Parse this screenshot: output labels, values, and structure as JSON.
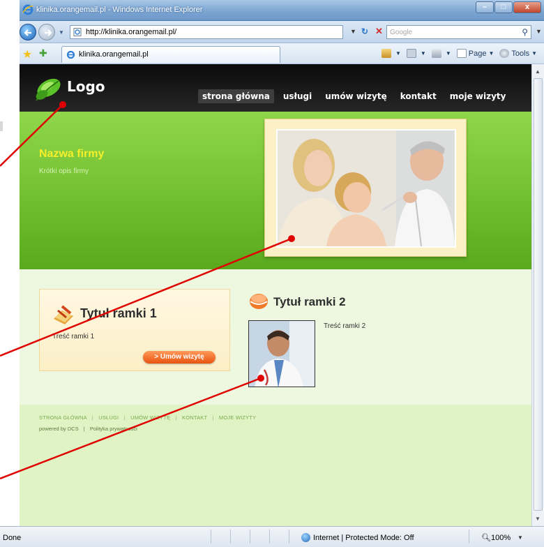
{
  "window": {
    "title": "klinika.orangemail.pl - Windows Internet Explorer",
    "controls": [
      "–",
      "□",
      "x"
    ]
  },
  "address_bar": {
    "url": "http://klinika.orangemail.pl/",
    "search_placeholder": "Google"
  },
  "tab": {
    "label": "klinika.orangemail.pl"
  },
  "command_bar": {
    "page_label": "Page",
    "tools_label": "Tools"
  },
  "site": {
    "logo_text": "Logo",
    "nav": [
      {
        "label": "strona główna",
        "active": true
      },
      {
        "label": "usługi",
        "active": false
      },
      {
        "label": "umów wizytę",
        "active": false
      },
      {
        "label": "kontakt",
        "active": false
      },
      {
        "label": "moje wizyty",
        "active": false
      }
    ],
    "hero": {
      "company_name": "Nazwa firmy",
      "tagline": "Krótki opis firmy"
    },
    "box1": {
      "title": "Tytuł ramki 1",
      "text": "Treść ramki 1",
      "button_label": "> Umów wizytę"
    },
    "box2": {
      "title": "Tytuł ramki 2",
      "text": "Treść ramki 2"
    },
    "footer": {
      "links": [
        "STRONA GŁÓWNA",
        "USŁUGI",
        "UMÓW WIZYTĘ",
        "KONTAKT",
        "MOJE WIZYTY"
      ],
      "separator": "|",
      "powered": "powered by DCS",
      "policy": "Polityka prywatności"
    }
  },
  "status_bar": {
    "status": "Done",
    "zone": "Internet | Protected Mode: Off",
    "zoom": "100%"
  },
  "colors": {
    "header_bg": "#111111",
    "hero_green": "#6fbd2c",
    "company_yellow": "#f7ef2a",
    "button_orange": "#e8530f",
    "footer_bg": "#dff3c4",
    "annotation_red": "#e00000"
  }
}
